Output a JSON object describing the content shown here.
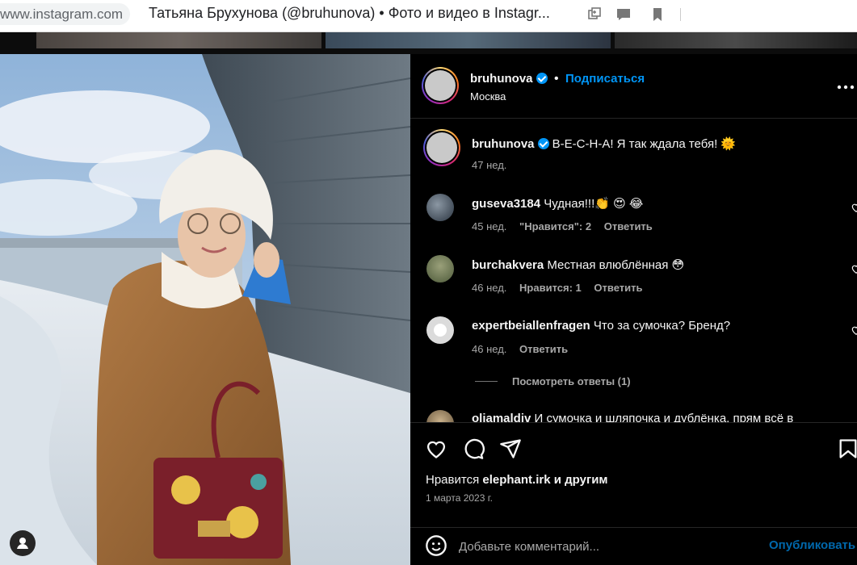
{
  "browser": {
    "url": "www.instagram.com",
    "tab_title": "Татьяна Брухунова (@bruhunova) • Фото и видео в Instagr..."
  },
  "post": {
    "author": "bruhunova",
    "follow_label": "Подписаться",
    "location": "Москва",
    "caption_text": "В-Е-С-Н-А! Я так ждала тебя! 🌞",
    "caption_time": "47 нед."
  },
  "comments": [
    {
      "user": "guseva3184",
      "text": "Чудная!!!👏 😍 😂",
      "time": "45 нед.",
      "likes": "\"Нравится\": 2",
      "reply": "Ответить"
    },
    {
      "user": "burchakvera",
      "text": "Местная влюблённая 😳",
      "time": "46 нед.",
      "likes": "Нравится: 1",
      "reply": "Ответить"
    },
    {
      "user": "expertbeiallenfragen",
      "text": "Что за сумочка? Бренд?",
      "time": "46 нед.",
      "reply": "Ответить"
    },
    {
      "user": "oliamaldiv",
      "text": "И сумочка и шляпочка и дублёнка, прям всё в"
    }
  ],
  "view_replies": "Посмотреть ответы (1)",
  "likes_prefix": "Нравится",
  "likes_user": "elephant.irk",
  "likes_suffix": "и другим",
  "post_date": "1 марта 2023 г.",
  "comment_placeholder": "Добавьте комментарий...",
  "publish_label": "Опубликовать",
  "icons": {
    "like": "heart-icon",
    "comment": "comment-icon",
    "share": "paper-plane-icon",
    "save": "bookmark-icon",
    "emoji": "smiley-icon",
    "more": "more-dots-icon",
    "user": "user-icon"
  },
  "colors": {
    "accent": "#0095f6",
    "background": "#000000",
    "secondary_text": "#a8a8a8"
  }
}
